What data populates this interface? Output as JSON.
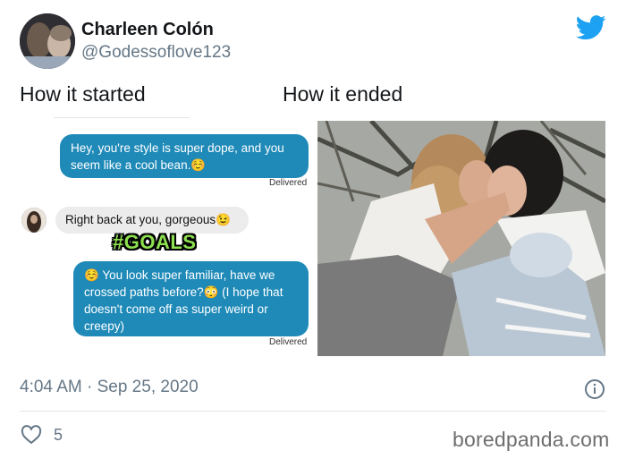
{
  "author": {
    "display_name": "Charleen Colón",
    "handle": "@Godessoflove123"
  },
  "captions": {
    "left": "How it started",
    "right": "How it ended"
  },
  "chat": {
    "message_1": "Hey, you're style is super dope, and you seem like a cool bean.☺️",
    "delivered_1": "Delivered",
    "reply": "Right back at you, gorgeous😉",
    "goals_sticker": "#GOALS",
    "message_2": "☺️ You look super familiar, have we crossed paths before?😳 (I hope that doesn't come off as super weird or creepy)",
    "delivered_2": "Delivered"
  },
  "tweet": {
    "timestamp": "4:04 AM · Sep 25, 2020",
    "likes": "5"
  },
  "watermark": "boredpanda.com",
  "colors": {
    "twitter_blue": "#1da1f2",
    "bubble_out": "#1f8ab8",
    "bubble_in": "#ececec",
    "goals_green": "#8de04f",
    "secondary_text": "#657786"
  },
  "icons": {
    "brand": "twitter-bird-icon",
    "info": "info-icon",
    "like": "heart-icon"
  }
}
